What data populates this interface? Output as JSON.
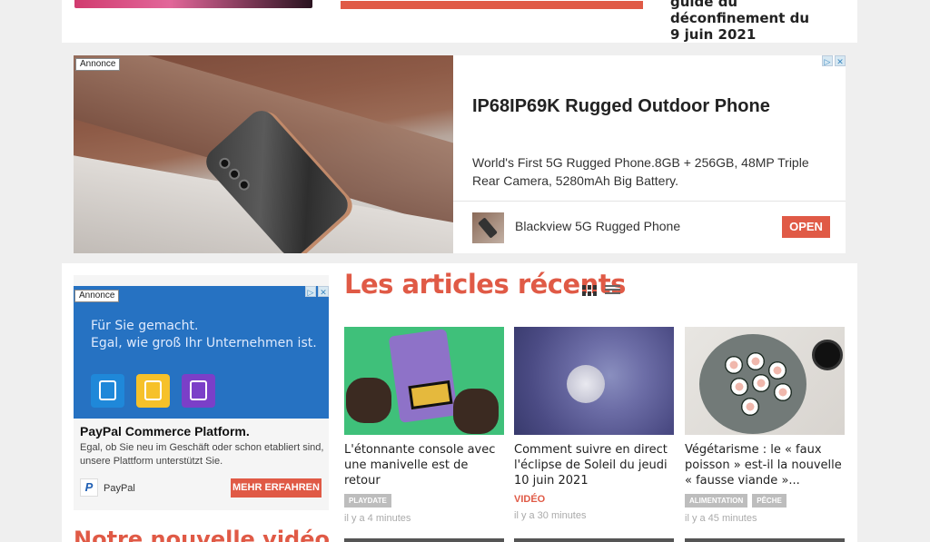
{
  "top": {
    "title_line": "guide du déconfinement du",
    "title_line2": "9 juin 2021"
  },
  "ad_big": {
    "badge": "Annonce",
    "title": "IP68IP69K Rugged Outdoor Phone",
    "description": "World's First 5G Rugged Phone.8GB + 256GB, 48MP Triple Rear Camera, 5280mAh Big Battery.",
    "brand": "Blackview 5G Rugged Phone",
    "cta": "OPEN",
    "adchoices_play": "▷",
    "adchoices_close": "✕"
  },
  "ad_side": {
    "badge": "Annonce",
    "banner_line1": "Für Sie gemacht.",
    "banner_line2": "Egal, wie groß Ihr Unternehmen ist.",
    "title": "PayPal Commerce Platform.",
    "description": "Egal, ob Sie neu im Geschäft oder schon etabliert sind, unsere Plattform unterstützt Sie.",
    "brand": "PayPal",
    "logo": "P",
    "cta": "MEHR ERFAHREN",
    "adchoices_play": "▷",
    "adchoices_close": "✕"
  },
  "video_section": {
    "title": "Notre nouvelle vidéo"
  },
  "recent": {
    "title": "Les articles récents",
    "view_icons": [
      "grid-view-icon",
      "list-view-icon"
    ],
    "articles": [
      {
        "title": "L'étonnante console avec une manivelle est de retour",
        "tags": [
          "PLAYDATE"
        ],
        "category": "",
        "time": "il y a 4 minutes"
      },
      {
        "title": "Comment suivre en direct l'éclipse de Soleil du jeudi 10 juin 2021",
        "tags": [],
        "category": "VIDÉO",
        "time": "il y a 30 minutes"
      },
      {
        "title": "Végétarisme : le « faux poisson » est-il la nouvelle « fausse viande »...",
        "tags": [
          "ALIMENTATION",
          "PÊCHE"
        ],
        "category": "",
        "time": "il y a 45 minutes"
      }
    ]
  },
  "colors": {
    "accent": "#e05a46",
    "paypal_blue": "#2672c2",
    "tag_gray": "#bdbdbd"
  }
}
